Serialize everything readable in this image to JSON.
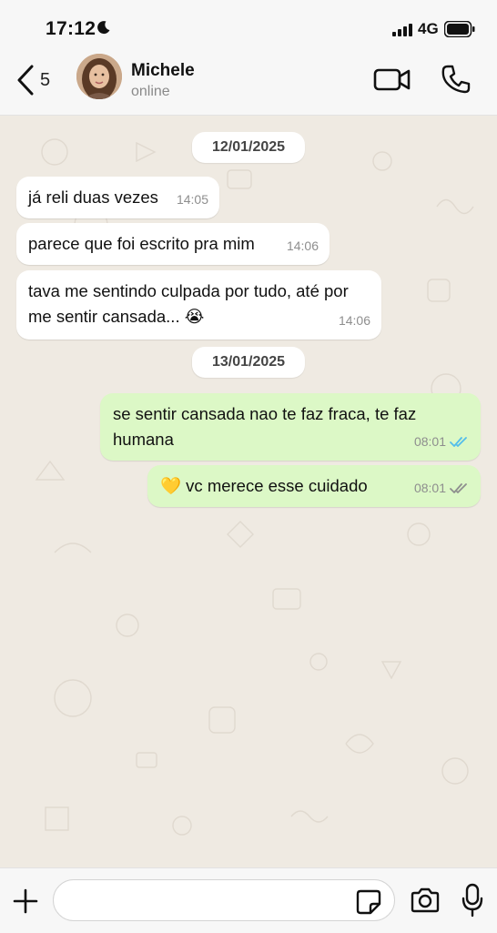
{
  "status_bar": {
    "time": "17:12",
    "network": "4G",
    "icons": [
      "moon-icon",
      "signal-icon",
      "battery-icon"
    ]
  },
  "header": {
    "back_count": "5",
    "contact_name": "Michele",
    "contact_status": "online",
    "icons": [
      "chevron-left-icon",
      "video-call-icon",
      "phone-icon"
    ]
  },
  "chat": {
    "date_1": "12/01/2025",
    "date_2": "13/01/2025",
    "messages": [
      {
        "direction": "in",
        "text": "já reli duas vezes",
        "time": "14:05"
      },
      {
        "direction": "in",
        "text": "parece que foi escrito pra mim",
        "time": "14:06"
      },
      {
        "direction": "in",
        "text": "tava me sentindo culpada por tudo, até por me sentir cansada... 😭",
        "time": "14:06"
      },
      {
        "direction": "out",
        "text": "se sentir cansada nao te faz fraca, te faz humana",
        "time": "08:01",
        "status": "read"
      },
      {
        "direction": "out",
        "text": "💛 vc merece esse cuidado",
        "time": "08:01",
        "status": "delivered"
      }
    ]
  },
  "input_bar": {
    "placeholder": "",
    "value": "",
    "icons": [
      "plus-icon",
      "sticker-icon",
      "camera-icon",
      "microphone-icon"
    ]
  },
  "colors": {
    "chat_background": "#efeae2",
    "incoming_bubble": "#ffffff",
    "outgoing_bubble": "#dcf8c6",
    "read_ticks": "#53bdeb",
    "delivered_ticks": "#8e8e8e"
  }
}
